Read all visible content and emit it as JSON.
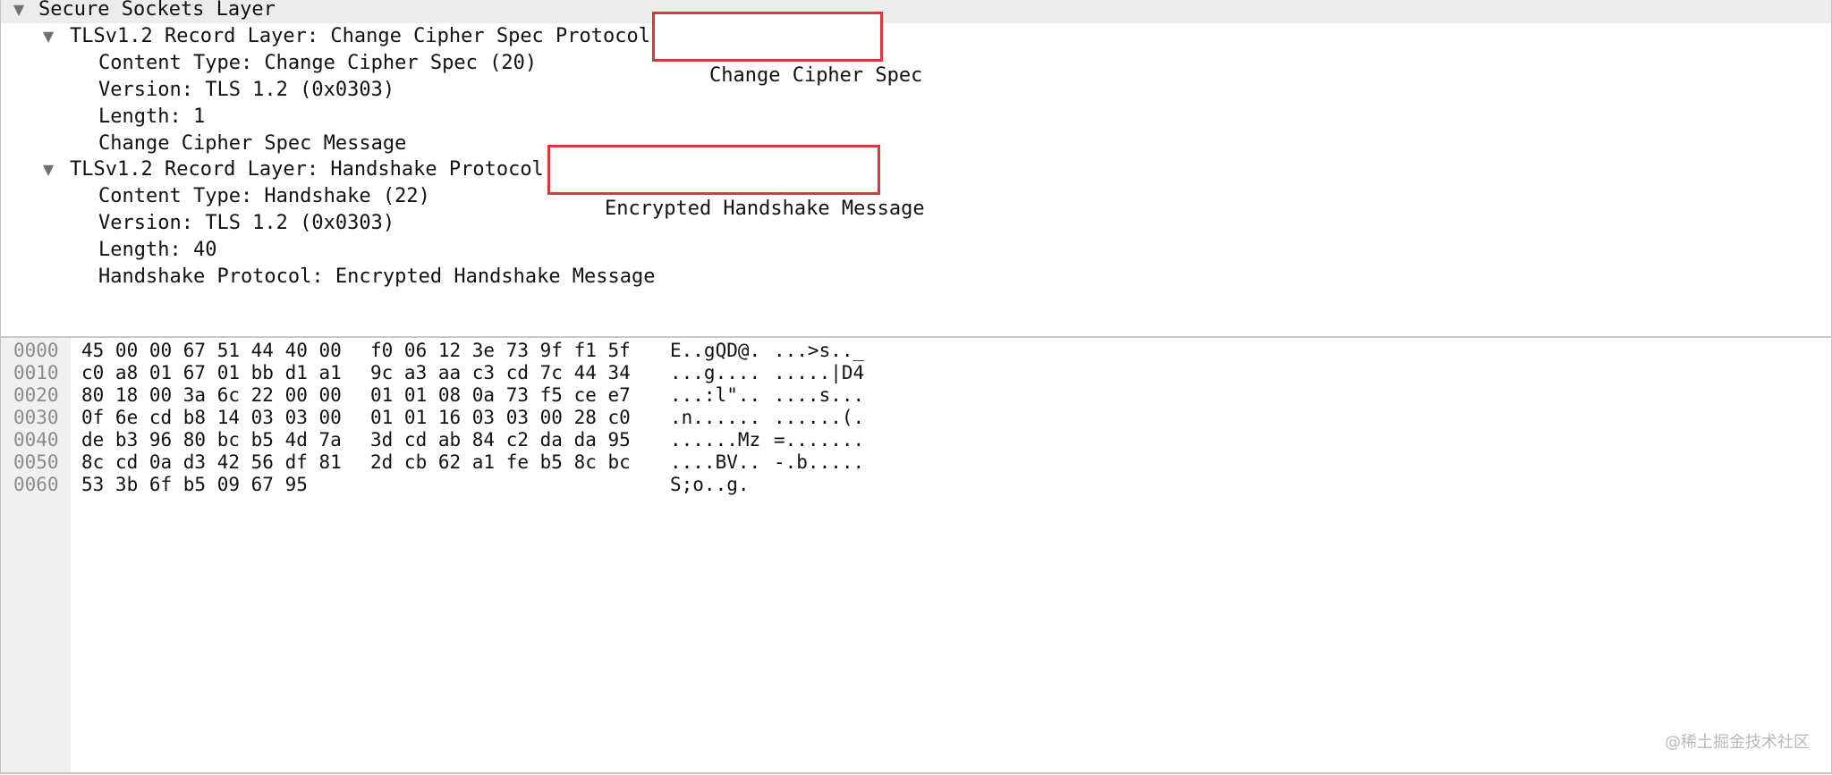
{
  "details": {
    "root": {
      "label": "Secure Sockets Layer"
    },
    "records": [
      {
        "header": "TLSv1.2 Record Layer: Change Cipher Spec Protocol:",
        "highlight": "Change Cipher Spec",
        "fields": [
          "Content Type: Change Cipher Spec (20)",
          "Version: TLS 1.2 (0x0303)",
          "Length: 1",
          "Change Cipher Spec Message"
        ]
      },
      {
        "header": "TLSv1.2 Record Layer: Handshake Protocol:",
        "highlight": "Encrypted Handshake Message",
        "fields": [
          "Content Type: Handshake (22)",
          "Version: TLS 1.2 (0x0303)",
          "Length: 40",
          "Handshake Protocol: Encrypted Handshake Message"
        ]
      }
    ],
    "highlight_color": "#d63a3a",
    "expander_icon": "triangle-down-icon"
  },
  "bytes": {
    "lines": [
      {
        "offset": "0000",
        "hex_a": "45 00 00 67 51 44 40 00",
        "hex_b": "f0 06 12 3e 73 9f f1 5f",
        "ascii_a": "E..gQD@.",
        "ascii_b": "...>s.._"
      },
      {
        "offset": "0010",
        "hex_a": "c0 a8 01 67 01 bb d1 a1",
        "hex_b": "9c a3 aa c3 cd 7c 44 34",
        "ascii_a": "...g....",
        "ascii_b": ".....|D4"
      },
      {
        "offset": "0020",
        "hex_a": "80 18 00 3a 6c 22 00 00",
        "hex_b": "01 01 08 0a 73 f5 ce e7",
        "ascii_a": "...:l\"..",
        "ascii_b": "....s..."
      },
      {
        "offset": "0030",
        "hex_a": "0f 6e cd b8 14 03 03 00",
        "hex_b": "01 01 16 03 03 00 28 c0",
        "ascii_a": ".n......",
        "ascii_b": "......(."
      },
      {
        "offset": "0040",
        "hex_a": "de b3 96 80 bc b5 4d 7a",
        "hex_b": "3d cd ab 84 c2 da da 95",
        "ascii_a": "......Mz",
        "ascii_b": "=......."
      },
      {
        "offset": "0050",
        "hex_a": "8c cd 0a d3 42 56 df 81",
        "hex_b": "2d cb 62 a1 fe b5 8c bc",
        "ascii_a": "....BV..",
        "ascii_b": "-.b....."
      },
      {
        "offset": "0060",
        "hex_a": "53 3b 6f b5 09 67 95",
        "hex_b": "",
        "ascii_a": "S;o..g.",
        "ascii_b": ""
      }
    ]
  },
  "watermark": "@稀土掘金技术社区"
}
